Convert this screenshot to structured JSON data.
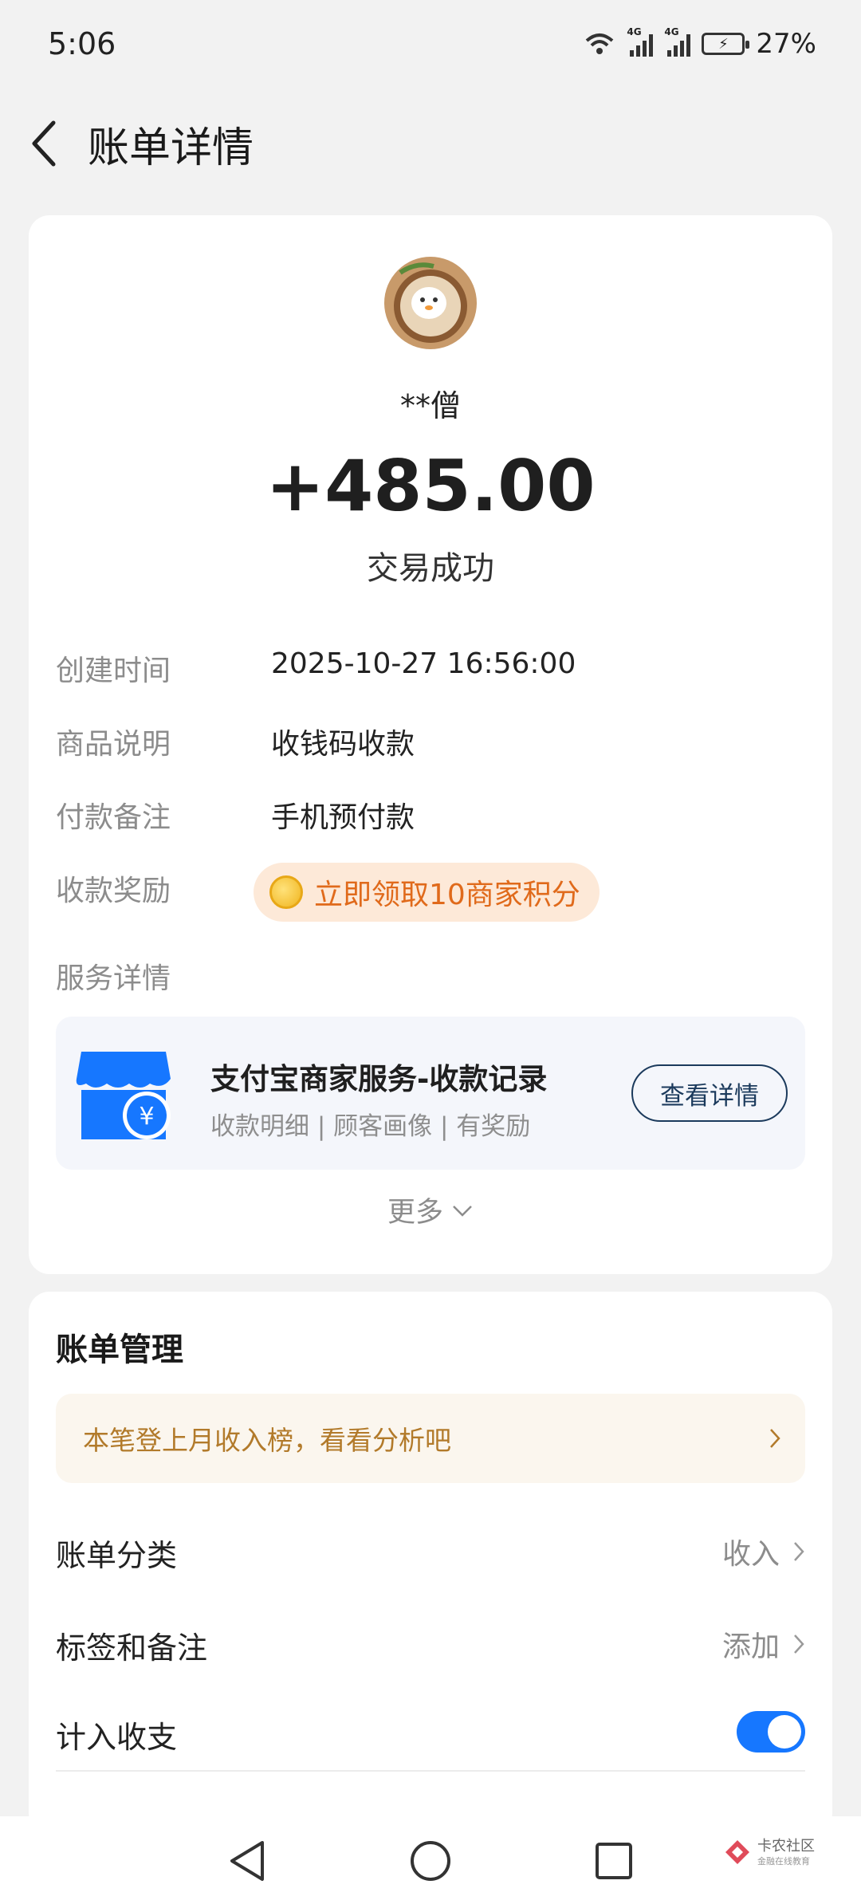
{
  "status_bar": {
    "time": "5:06",
    "battery": "27%",
    "net1": "4G",
    "net2": "4G"
  },
  "header": {
    "title": "账单详情"
  },
  "transaction": {
    "payer": "**僧",
    "amount": "+485.00",
    "status": "交易成功"
  },
  "info_rows": [
    {
      "label": "创建时间",
      "value": "2025-10-27 16:56:00"
    },
    {
      "label": "商品说明",
      "value": "收钱码收款"
    },
    {
      "label": "付款备注",
      "value": "手机预付款"
    }
  ],
  "reward": {
    "label": "收款奖励",
    "text": "立即领取10商家积分"
  },
  "service": {
    "label": "服务详情",
    "title": "支付宝商家服务-收款记录",
    "subtitle": "收款明细 | 顾客画像 | 有奖励",
    "button": "查看详情"
  },
  "more": {
    "label": "更多"
  },
  "management": {
    "title": "账单管理",
    "promo": "本笔登上月收入榜，看看分析吧",
    "rows": [
      {
        "label": "账单分类",
        "value": "收入"
      },
      {
        "label": "标签和备注",
        "value": "添加"
      }
    ],
    "toggle_label": "计入收支",
    "toggle_on": true
  },
  "watermark": {
    "main": "卡农社区",
    "sub": "金融在线教育"
  },
  "colors": {
    "accent": "#1677ff",
    "reward": "#e06a1b",
    "promo": "#b27a2a"
  }
}
